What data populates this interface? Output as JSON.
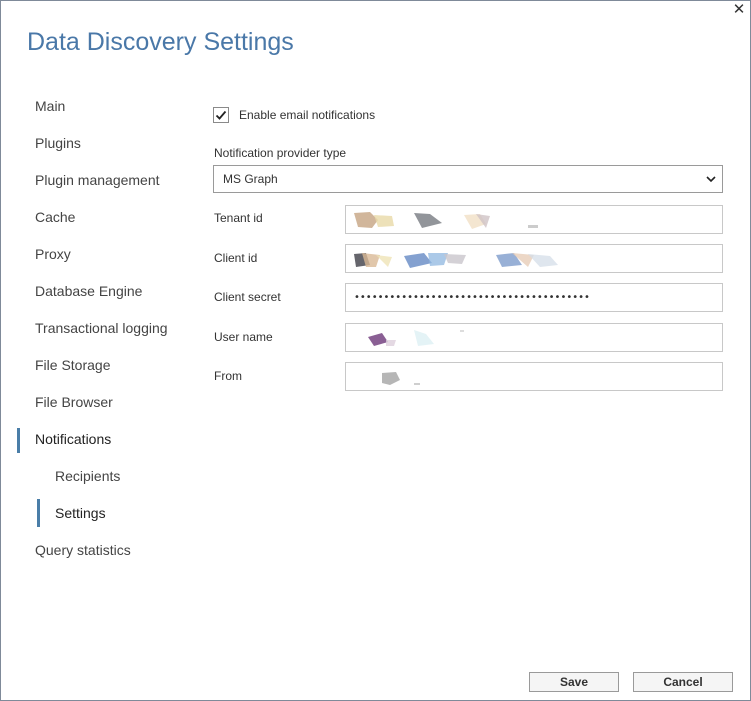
{
  "window": {
    "title": "Data Discovery Settings",
    "close_glyph": "✕"
  },
  "nav": {
    "items": [
      {
        "label": "Main",
        "active": false
      },
      {
        "label": "Plugins",
        "active": false
      },
      {
        "label": "Plugin management",
        "active": false
      },
      {
        "label": "Cache",
        "active": false
      },
      {
        "label": "Proxy",
        "active": false
      },
      {
        "label": "Database Engine",
        "active": false
      },
      {
        "label": "Transactional logging",
        "active": false
      },
      {
        "label": "File Storage",
        "active": false
      },
      {
        "label": "File Browser",
        "active": false
      },
      {
        "label": "Notifications",
        "active": true
      },
      {
        "label": "Recipients",
        "active": false,
        "sub": true
      },
      {
        "label": "Settings",
        "active": true,
        "sub": true
      },
      {
        "label": "Query statistics",
        "active": false
      }
    ]
  },
  "form": {
    "enable_email_label": "Enable email notifications",
    "enable_email_checked": true,
    "provider_label": "Notification provider type",
    "provider_value": "MS Graph",
    "fields": {
      "tenant_label": "Tenant id",
      "client_label": "Client id",
      "secret_label": "Client secret",
      "secret_value": "••••••••••••••••••••••••••••••••••••••••",
      "username_label": "User name",
      "from_label": "From"
    }
  },
  "buttons": {
    "save": "Save",
    "cancel": "Cancel"
  },
  "colors": {
    "title": "#4a78a8",
    "active_indicator": "#4a7ea8"
  }
}
